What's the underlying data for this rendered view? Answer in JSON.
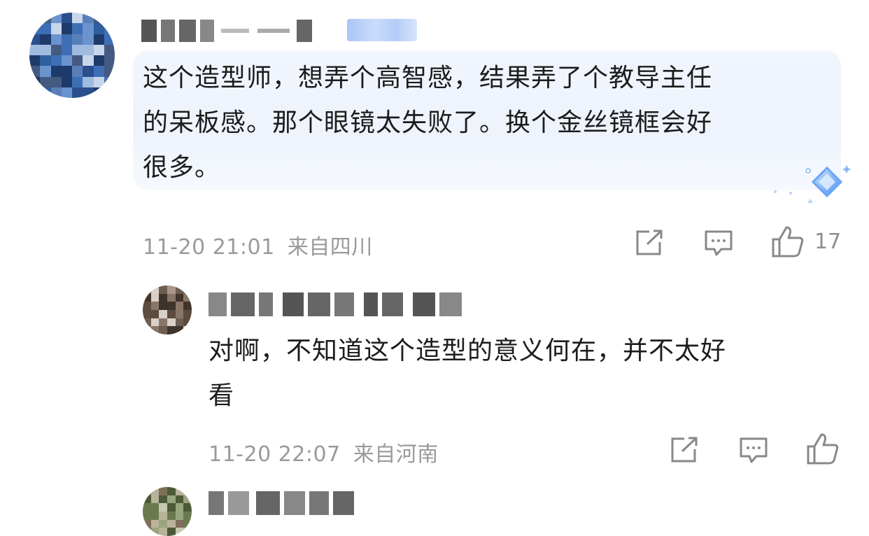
{
  "main_comment": {
    "text": "这个造型师，想弄个高智感，结果弄了个教导主任的呆板感。那个眼镜太失败了。换个金丝镜框会好很多。",
    "line1": "这个造型师，想弄个高智感，结果弄了个教导主任",
    "line2": "的呆板感。那个眼镜太失败了。换个金丝镜框会好",
    "line3": "很多。",
    "time": "11-20 21:01",
    "location": "来自四川",
    "like_count": "17"
  },
  "reply_comment": {
    "line1": "对啊，不知道这个造型的意义何在，并不太好",
    "line2": "看",
    "time": "11-20 22:07",
    "location": "来自河南"
  },
  "icons": {
    "share": "share-icon",
    "comment": "comment-icon",
    "like": "thumbs-up-icon",
    "decoration": "diamond-badge-icon"
  },
  "colors": {
    "text": "#1c1c1c",
    "meta": "#9a9a9a",
    "bubble": "#eef3fc",
    "badge": "#b3cdf7"
  }
}
